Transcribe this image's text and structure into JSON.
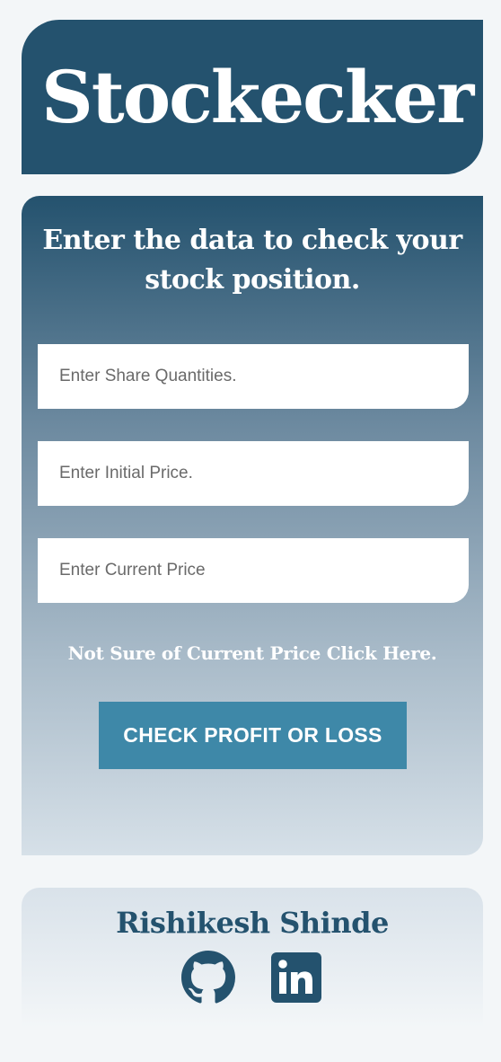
{
  "header": {
    "title": "Stockecker"
  },
  "form": {
    "heading": "Enter the data to check your stock position.",
    "fields": {
      "quantity_placeholder": "Enter Share Quantities.",
      "initial_placeholder": "Enter Initial Price.",
      "current_placeholder": "Enter Current Price"
    },
    "current_price_link": "Not Sure of Current Price Click Here.",
    "submit_label": "CHECK PROFIT OR LOSS"
  },
  "footer": {
    "author": "Rishikesh Shinde",
    "links": [
      {
        "icon": "github-icon"
      },
      {
        "icon": "linkedin-icon"
      }
    ]
  },
  "colors": {
    "primary": "#24526e",
    "button": "#3e88a8",
    "background": "#f3f6f8"
  }
}
